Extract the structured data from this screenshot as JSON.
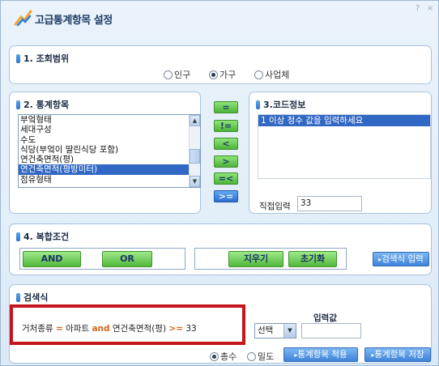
{
  "window": {
    "title": "고급통계항목 설정",
    "controls": [
      "?",
      "×"
    ]
  },
  "scope": {
    "header": "1. 조회범위",
    "options": [
      {
        "label": "인구",
        "checked": false
      },
      {
        "label": "가구",
        "checked": true
      },
      {
        "label": "사업체",
        "checked": false
      }
    ]
  },
  "stats": {
    "header": "2. 통계항목",
    "items": [
      "부엌형태",
      "세대구성",
      "수도",
      "식당(부엌이 딸린식당 포함)",
      "연건축면적(평)",
      "연건축면적(평방미터)",
      "점유형태"
    ],
    "selected_index": 5
  },
  "operators": {
    "labels": [
      "=",
      "!=",
      "<",
      ">",
      "=<",
      ">="
    ],
    "active_index": 5
  },
  "code": {
    "header": "3.코드정보",
    "list_item": "1 이상 정수 값을 입력하세요",
    "direct_label": "직접입력",
    "direct_value": "33"
  },
  "compound": {
    "header": "4. 복합조건",
    "and_label": "AND",
    "or_label": "OR",
    "clear_label": "지우기",
    "reset_label": "초기화",
    "input_label": "검색식 입력"
  },
  "search": {
    "header": "검색식",
    "expr_field": "거처종류",
    "expr_op1": "=",
    "expr_value1": "아파트",
    "expr_and": "and",
    "expr_field2": "연건축면적(평)",
    "expr_op2": ">=",
    "expr_value2": "33",
    "select_value": "선택",
    "input_label": "입력값",
    "input_value": "",
    "mode_options": [
      {
        "label": "총수",
        "checked": true
      },
      {
        "label": "밀도",
        "checked": false
      }
    ],
    "apply_label": "통계항목 적용",
    "save_label": "통계항목 저장"
  },
  "colors": {
    "accent_blue": "#3168c4",
    "button_green": "#52b83b",
    "highlight_red": "#c4161c",
    "operator_orange": "#d8631a"
  }
}
